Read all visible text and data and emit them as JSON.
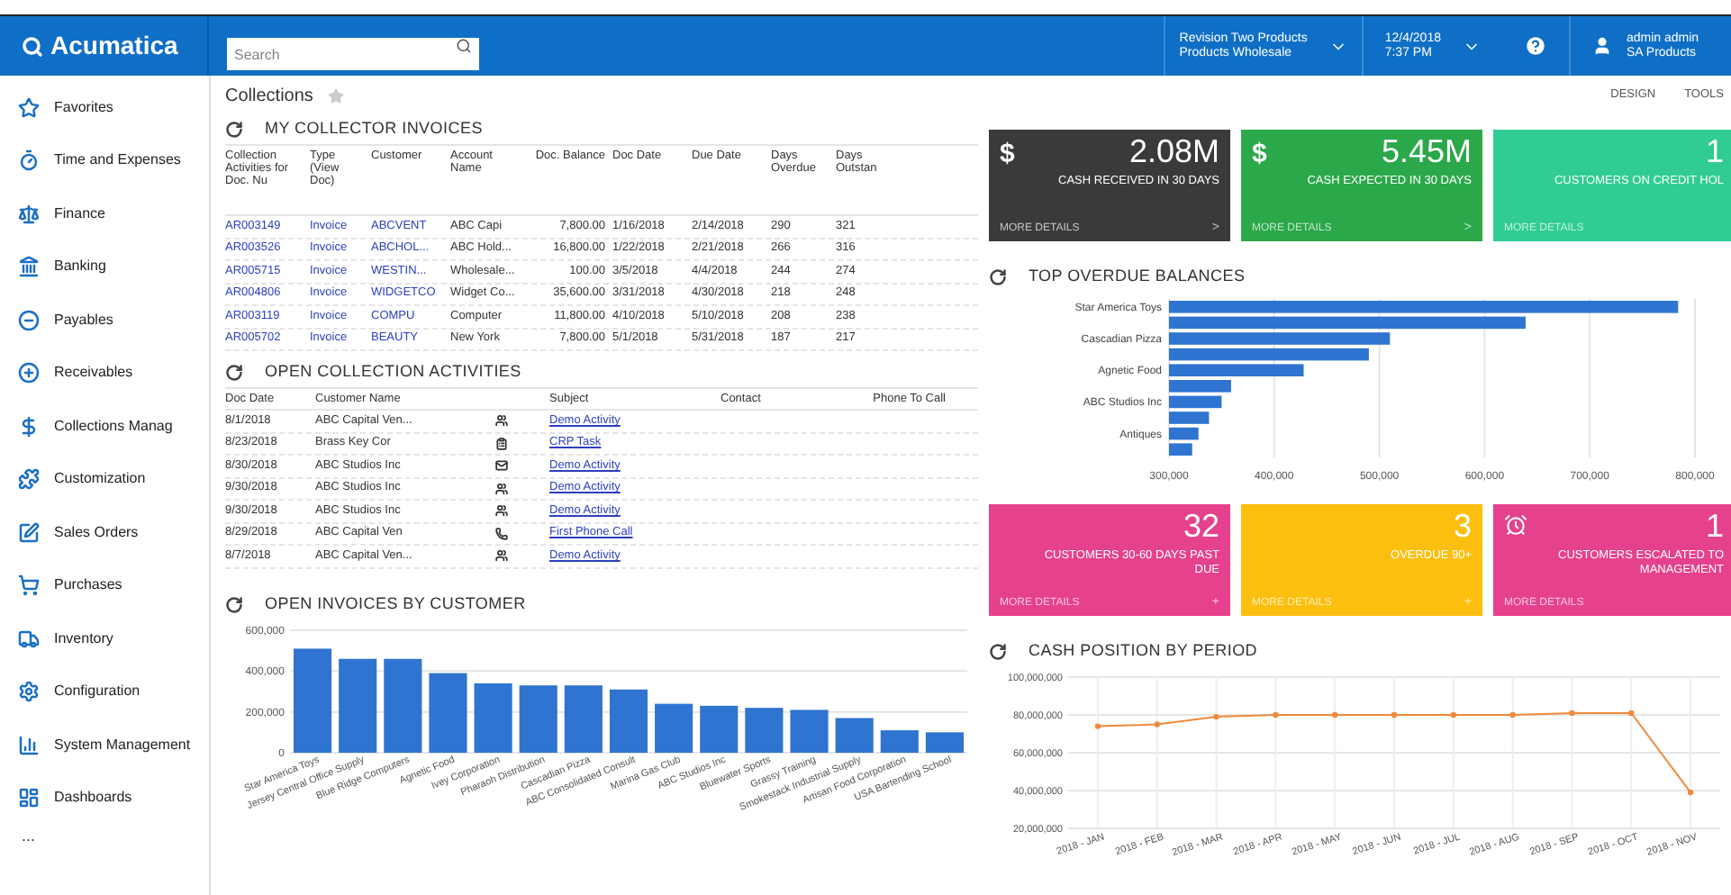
{
  "header": {
    "logo": "Acumatica",
    "search": {
      "placeholder": "Search"
    },
    "company": {
      "line1": "Revision Two Products",
      "line2": "Products Wholesale"
    },
    "date": {
      "line1": "12/4/2018",
      "line2": "7:37 PM"
    },
    "user": {
      "line1": "admin admin",
      "line2": "SA Products"
    }
  },
  "sidebar": {
    "items": [
      {
        "label": "Favorites"
      },
      {
        "label": "Time and Expenses"
      },
      {
        "label": "Finance"
      },
      {
        "label": "Banking"
      },
      {
        "label": "Payables"
      },
      {
        "label": "Receivables"
      },
      {
        "label": "Collections Manag"
      },
      {
        "label": "Customization"
      },
      {
        "label": "Sales Orders"
      },
      {
        "label": "Purchases"
      },
      {
        "label": "Inventory"
      },
      {
        "label": "Configuration"
      },
      {
        "label": "System Management"
      },
      {
        "label": "Dashboards"
      }
    ],
    "more": "..."
  },
  "page": {
    "title": "Collections",
    "actions": [
      "DESIGN",
      "TOOLS"
    ]
  },
  "invoices": {
    "title": "MY COLLECTOR INVOICES",
    "columns": [
      "Collection Activities for Doc. Nu",
      "Type (View Doc)",
      "Customer",
      "Account Name",
      "Doc. Balance",
      "Doc Date",
      "Due Date",
      "Days Overdue",
      "Days Outstan"
    ],
    "rows": [
      [
        "AR003149",
        "Invoice",
        "ABCVENT",
        "ABC Capi",
        "7,800.00",
        "1/16/2018",
        "2/14/2018",
        "290",
        "321"
      ],
      [
        "AR003526",
        "Invoice",
        "ABCHOL...",
        "ABC Hold...",
        "16,800.00",
        "1/22/2018",
        "2/21/2018",
        "266",
        "316"
      ],
      [
        "AR005715",
        "Invoice",
        "WESTIN...",
        "Wholesale...",
        "100.00",
        "3/5/2018",
        "4/4/2018",
        "244",
        "274"
      ],
      [
        "AR004806",
        "Invoice",
        "WIDGETCO",
        "Widget Co...",
        "35,600.00",
        "3/31/2018",
        "4/30/2018",
        "218",
        "248"
      ],
      [
        "AR003119",
        "Invoice",
        "COMPU",
        "Computer",
        "11,800.00",
        "4/10/2018",
        "5/10/2018",
        "208",
        "238"
      ],
      [
        "AR005702",
        "Invoice",
        "BEAUTY",
        "New York",
        "7,800.00",
        "5/1/2018",
        "5/31/2018",
        "187",
        "217"
      ]
    ]
  },
  "activities": {
    "title": "OPEN COLLECTION ACTIVITIES",
    "columns": [
      "Doc Date",
      "Customer Name",
      "Subject",
      "Contact",
      "Phone To Call"
    ],
    "rows": [
      {
        "date": "8/1/2018",
        "customer": "ABC Capital Ven...",
        "kind": "activity",
        "subject": "Demo Activity"
      },
      {
        "date": "8/23/2018",
        "customer": "Brass Key Cor",
        "kind": "task",
        "subject": "CRP Task"
      },
      {
        "date": "8/30/2018",
        "customer": "ABC Studios Inc",
        "kind": "email",
        "subject": "Demo Activity"
      },
      {
        "date": "9/30/2018",
        "customer": "ABC Studios Inc",
        "kind": "activity",
        "subject": "Demo Activity"
      },
      {
        "date": "9/30/2018",
        "customer": "ABC Studios Inc",
        "kind": "activity",
        "subject": "Demo Activity"
      },
      {
        "date": "8/29/2018",
        "customer": "ABC Capital Ven",
        "kind": "phone",
        "subject": "First Phone Call"
      },
      {
        "date": "8/7/2018",
        "customer": "ABC Capital Ven...",
        "kind": "activity",
        "subject": "Demo Activity"
      }
    ]
  },
  "open_invoices": {
    "title": "OPEN INVOICES BY CUSTOMER",
    "chart_data": {
      "type": "bar",
      "categories": [
        "Star America Toys",
        "Jersey Central Office Supply",
        "Blue Ridge Computers",
        "Agnetic Food",
        "Ivey Corporation",
        "Pharaoh Distribution",
        "Cascadian Pizza",
        "ABC Consolidated Consult",
        "Marina Gas Club",
        "ABC Studios Inc",
        "Bluewater Sports",
        "Grassy Training",
        "Smokestack Industrial Supply",
        "Artisan Food Corporation",
        "USA Bartending School"
      ],
      "grid": true,
      "series": [
        {
          "color": "#2f74d0",
          "values": [
            510000,
            460000,
            460000,
            390000,
            340000,
            330000,
            330000,
            310000,
            240000,
            230000,
            220000,
            210000,
            170000,
            110000,
            100000
          ]
        }
      ],
      "ylim": [
        0,
        600000
      ],
      "yticks": [
        {
          "value": 0,
          "label": "0"
        },
        {
          "value": 200000,
          "label": "200,000"
        },
        {
          "value": 400000,
          "label": "400,000"
        },
        {
          "value": 600000,
          "label": "600,000"
        }
      ]
    }
  },
  "tiles_top": [
    {
      "kind": "symbol",
      "symbol": "$",
      "value": "2.08M",
      "label": "CASH RECEIVED IN 30 DAYS",
      "more": "MORE DETAILS",
      "arrow": ">",
      "color": "#3a3a3a"
    },
    {
      "kind": "symbol",
      "symbol": "$",
      "value": "5.45M",
      "label": "CASH EXPECTED IN 30 DAYS",
      "more": "MORE DETAILS",
      "arrow": ">",
      "color": "#2ba84a"
    },
    {
      "kind": "plain",
      "value": "1",
      "label": "CUSTOMERS ON CREDIT HOL",
      "more": "MORE DETAILS",
      "color": "#31cc93"
    }
  ],
  "overdue": {
    "title": "TOP OVERDUE BALANCES",
    "chart_data": {
      "type": "bar",
      "orientation": "horizontal",
      "categories": [
        "Star America Toys",
        null,
        "Cascadian Pizza",
        null,
        "Agnetic Food",
        null,
        "ABC Studios Inc",
        null,
        "Antiques",
        null
      ],
      "grid": true,
      "series": [
        {
          "color": "#2f74d0",
          "values": [
            784000,
            639000,
            510000,
            490000,
            428000,
            359000,
            350000,
            338000,
            328000,
            322000
          ]
        }
      ],
      "xlim": [
        300000,
        800000
      ],
      "xticks": [
        {
          "value": 300000,
          "label": "300,000"
        },
        {
          "value": 400000,
          "label": "400,000"
        },
        {
          "value": 500000,
          "label": "500,000"
        },
        {
          "value": 600000,
          "label": "600,000"
        },
        {
          "value": 700000,
          "label": "700,000"
        },
        {
          "value": 800000,
          "label": "800,000"
        }
      ]
    }
  },
  "tiles_bottom": [
    {
      "kind": "plain",
      "value": "32",
      "label": "CUSTOMERS 30-60 DAYS PAST DUE",
      "more": "MORE DETAILS",
      "arrow": "+",
      "color": "#e6418c"
    },
    {
      "kind": "plain",
      "value": "3",
      "label": "OVERDUE 90+",
      "more": "MORE DETAILS",
      "arrow": "+",
      "color": "#fdbf0f"
    },
    {
      "kind": "alarm",
      "value": "1",
      "label": "CUSTOMERS ESCALATED TO MANAGEMENT",
      "more": "MORE DETAILS",
      "color": "#e6418c"
    }
  ],
  "cash": {
    "title": "CASH POSITION BY PERIOD",
    "chart_data": {
      "type": "line",
      "categories": [
        "2018 - JAN",
        "2018 - FEB",
        "2018 - MAR",
        "2018 - APR",
        "2018 - MAY",
        "2018 - JUN",
        "2018 - JUL",
        "2018 - AUG",
        "2018 - SEP",
        "2018 - OCT",
        "2018 - NOV"
      ],
      "grid": true,
      "series": [
        {
          "color": "#f08a3c",
          "marker": true,
          "values": [
            74000000,
            75000000,
            79000000,
            80000000,
            80000000,
            80000000,
            80000000,
            80000000,
            81000000,
            81000000,
            39000000
          ]
        }
      ],
      "ylim": [
        20000000,
        100000000
      ],
      "yticks": [
        {
          "value": 20000000,
          "label": "20,000,000"
        },
        {
          "value": 40000000,
          "label": "40,000,000"
        },
        {
          "value": 60000000,
          "label": "60,000,000"
        },
        {
          "value": 80000000,
          "label": "80,000,000"
        },
        {
          "value": 100000000,
          "label": "100,000,000"
        }
      ]
    }
  }
}
